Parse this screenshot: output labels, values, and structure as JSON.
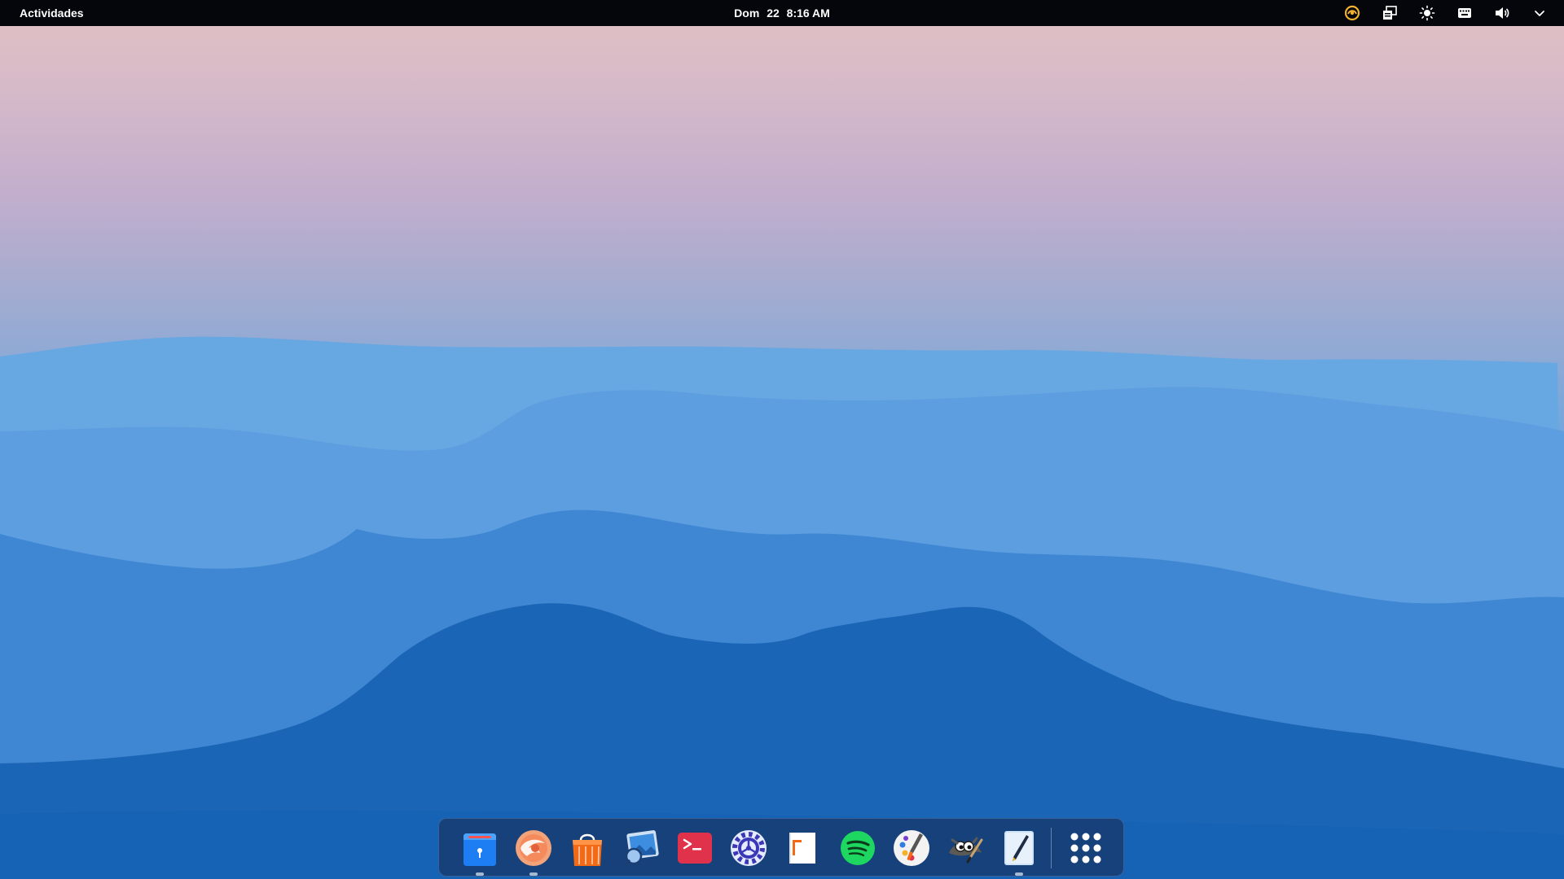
{
  "topbar": {
    "activities_label": "Actividades",
    "clock": {
      "day": "Dom",
      "date": "22",
      "time": "8:16 AM"
    },
    "tray": [
      {
        "name": "cloud-sync-icon",
        "color": "#f2b12e"
      },
      {
        "name": "screenshot-icon"
      },
      {
        "name": "brightness-icon"
      },
      {
        "name": "keyboard-icon"
      },
      {
        "name": "volume-icon"
      },
      {
        "name": "chevron-down-icon"
      }
    ]
  },
  "dock": {
    "apps": [
      {
        "name": "files-app",
        "icon": "folder-icon",
        "running": true
      },
      {
        "name": "browser-app",
        "icon": "browser-icon",
        "running": true
      },
      {
        "name": "software-center-app",
        "icon": "shopping-bag-icon",
        "running": false
      },
      {
        "name": "image-viewer-app",
        "icon": "photo-viewer-icon",
        "running": false
      },
      {
        "name": "terminal-app",
        "icon": "terminal-icon",
        "running": false
      },
      {
        "name": "settings-app",
        "icon": "gear-icon",
        "running": false
      },
      {
        "name": "text-editor-app",
        "icon": "document-icon",
        "running": false
      },
      {
        "name": "spotify-app",
        "icon": "spotify-icon",
        "running": false
      },
      {
        "name": "paint-app",
        "icon": "paint-brush-icon",
        "running": false
      },
      {
        "name": "gimp-app",
        "icon": "gimp-icon",
        "running": false
      },
      {
        "name": "notes-app",
        "icon": "pen-icon",
        "running": true
      }
    ],
    "show_apps": {
      "icon": "app-grid-icon"
    }
  },
  "colors": {
    "topbar": "#05060c",
    "sky_top": "#e2c1c3",
    "sky_mid": "#b9a9ca",
    "wave_light": "#67a7e2",
    "wave_deep": "#1460b3",
    "spotify_green": "#1ed760",
    "terminal_red": "#e0334b"
  }
}
